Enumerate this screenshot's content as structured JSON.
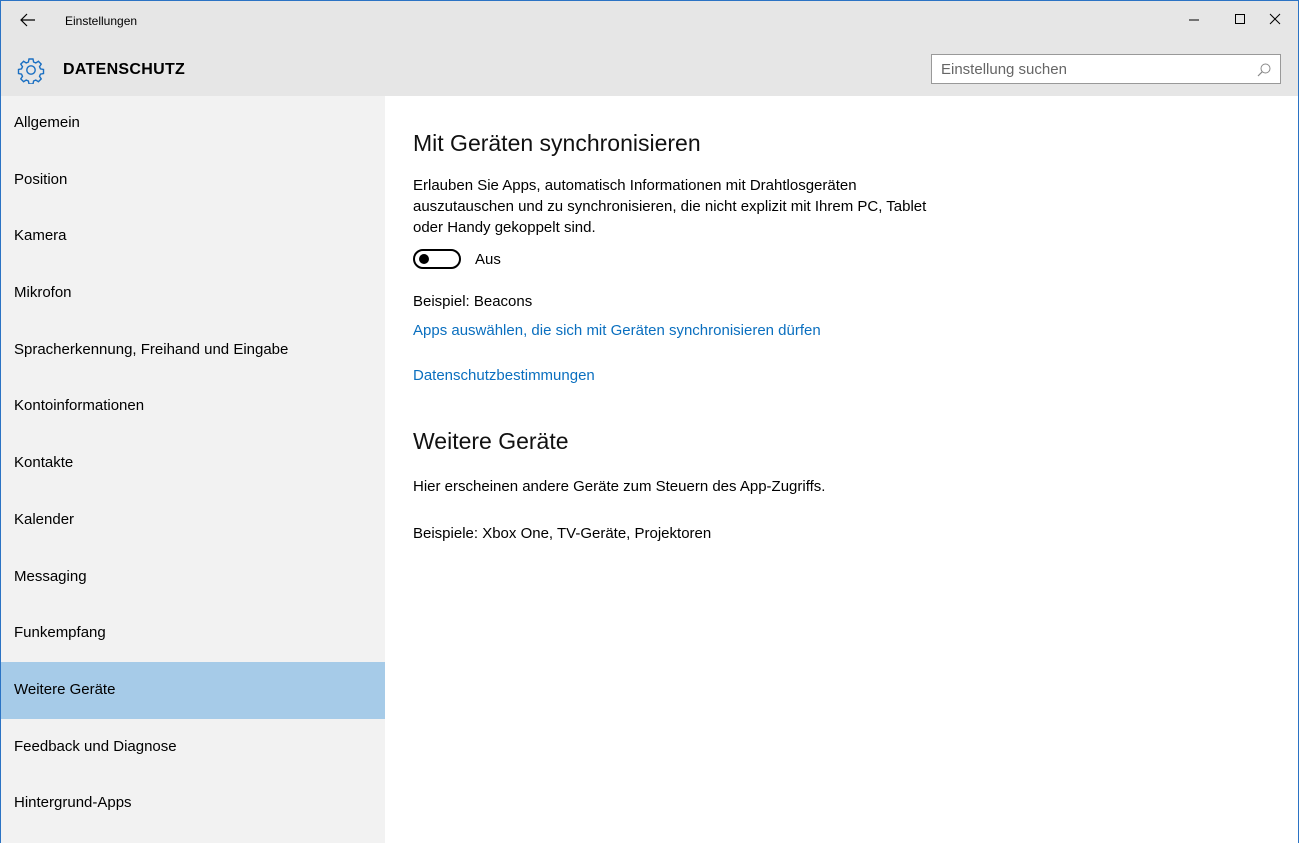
{
  "window": {
    "app_title": "Einstellungen",
    "controls": {
      "minimize": "minimize-icon",
      "maximize": "maximize-icon",
      "close": "close-icon"
    }
  },
  "header": {
    "title": "DATENSCHUTZ",
    "icon": "gear-icon",
    "search": {
      "placeholder": "Einstellung suchen",
      "value": ""
    }
  },
  "sidebar": {
    "items": [
      {
        "label": "Allgemein"
      },
      {
        "label": "Position"
      },
      {
        "label": "Kamera"
      },
      {
        "label": "Mikrofon"
      },
      {
        "label": "Spracherkennung, Freihand und Eingabe"
      },
      {
        "label": "Kontoinformationen"
      },
      {
        "label": "Kontakte"
      },
      {
        "label": "Kalender"
      },
      {
        "label": "Messaging"
      },
      {
        "label": "Funkempfang"
      },
      {
        "label": "Weitere Geräte"
      },
      {
        "label": "Feedback und Diagnose"
      },
      {
        "label": "Hintergrund-Apps"
      }
    ],
    "active_index": 10
  },
  "main": {
    "sync_section": {
      "title": "Mit Geräten synchronisieren",
      "description": "Erlauben Sie Apps, automatisch Informationen mit Drahtlosgeräten auszutauschen und zu synchronisieren, die nicht explizit mit Ihrem PC, Tablet oder Handy gekoppelt sind.",
      "toggle_state": "Aus",
      "example": "Beispiel: Beacons",
      "link_apps": "Apps auswählen, die sich mit Geräten synchronisieren dürfen",
      "link_privacy": "Datenschutzbestimmungen"
    },
    "other_devices": {
      "title": "Weitere Geräte",
      "description": "Hier erscheinen andere Geräte zum Steuern des App-Zugriffs.",
      "examples": "Beispiele: Xbox One, TV-Geräte, Projektoren"
    }
  },
  "colors": {
    "chrome_bg": "#e6e6e6",
    "sidebar_bg": "#f2f2f2",
    "active_item_bg": "#a6cbe8",
    "link": "#0a6fbf",
    "window_border": "#2b73c4"
  }
}
